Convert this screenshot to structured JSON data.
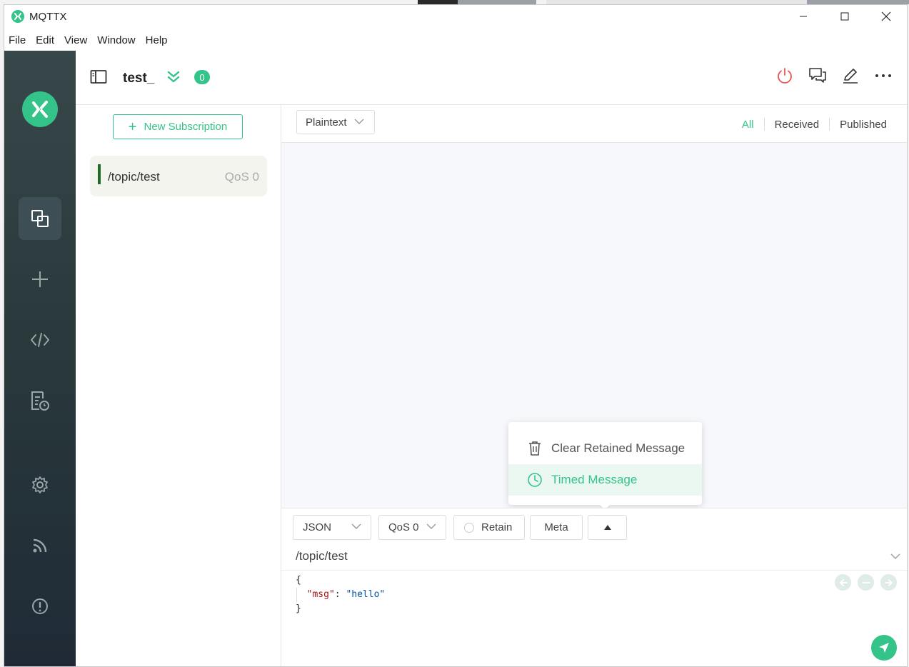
{
  "window": {
    "title": "MQTTX"
  },
  "menu": [
    "File",
    "Edit",
    "View",
    "Window",
    "Help"
  ],
  "sidebar": {
    "items": [
      {
        "name": "connections",
        "icon": "connections-icon",
        "active": true
      },
      {
        "name": "new-connection",
        "icon": "plus-icon",
        "active": false
      },
      {
        "name": "script",
        "icon": "code-icon",
        "active": false
      },
      {
        "name": "log",
        "icon": "log-icon",
        "active": false
      },
      {
        "name": "settings",
        "icon": "gear-icon",
        "active": false
      },
      {
        "name": "help",
        "icon": "rss-icon",
        "active": false
      },
      {
        "name": "about",
        "icon": "info-icon",
        "active": false
      }
    ]
  },
  "header": {
    "connection_name": "test_",
    "unread_count": "0",
    "actions": [
      "power-icon",
      "chat-icon",
      "edit-icon",
      "more-icon"
    ],
    "colors": {
      "accent": "#34c388",
      "disconnect": "#e8554e"
    }
  },
  "subscriptions": {
    "new_button": "New Subscription",
    "items": [
      {
        "topic": "/topic/test",
        "qos": "QoS 0",
        "color": "#1f6b26"
      }
    ]
  },
  "messages": {
    "format": "Plaintext",
    "filters": [
      "All",
      "Received",
      "Published"
    ],
    "active_filter": "All"
  },
  "popup": {
    "items": [
      {
        "label": "Clear Retained Message",
        "icon": "trash-icon"
      },
      {
        "label": "Timed Message",
        "icon": "clock-icon",
        "highlighted": true
      }
    ]
  },
  "publish": {
    "payload_type": "JSON",
    "qos": "QoS 0",
    "retain_label": "Retain",
    "meta_label": "Meta",
    "topic": "/topic/test",
    "payload": {
      "open": "{",
      "key": "\"msg\"",
      "colon": ": ",
      "value": "\"hello\"",
      "close": "}"
    }
  }
}
